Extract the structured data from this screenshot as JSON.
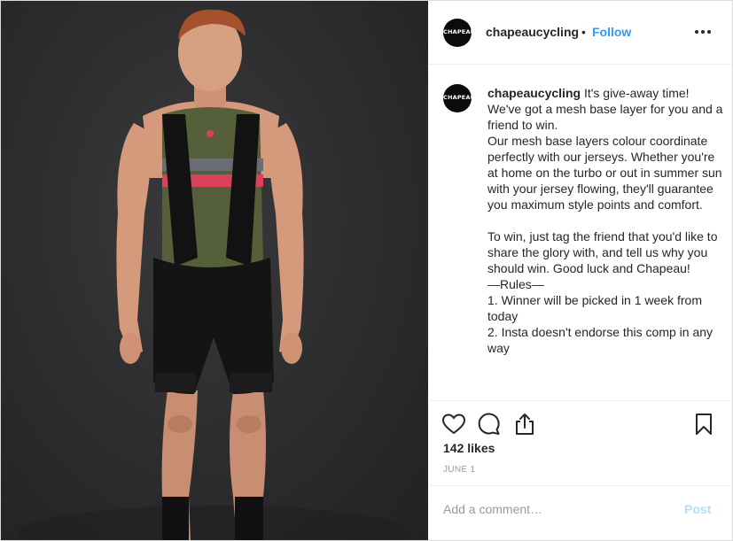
{
  "post": {
    "username": "chapeaucycling",
    "separator": "•",
    "follow_label": "Follow",
    "more_icon": "ellipsis-icon",
    "avatar_text": "CHAPEAU!",
    "caption": "It's give-away time! We've got a mesh base layer for you and a friend to win.\nOur mesh base layers colour coordinate perfectly with our jerseys. Whether you're at home on the turbo or out in summer sun with your jersey flowing, they'll guarantee you maximum style points and comfort.\n\nTo win, just tag the friend that you'd like to share the glory with, and tell us why you should win. Good luck and Chapeau!\n—Rules—\n1. Winner will be picked in 1 week from today\n2. Insta doesn't endorse this comp in any way",
    "likes": "142 likes",
    "date": "JUNE 1",
    "comment_placeholder": "Add a comment…",
    "post_label": "Post"
  },
  "icons": {
    "like": "heart-icon",
    "comment": "comment-bubble-icon",
    "share": "share-icon",
    "save": "bookmark-icon"
  },
  "colors": {
    "link_blue": "#3897f0",
    "post_disabled": "#b2dffc",
    "text": "#262626",
    "muted": "#999999"
  }
}
